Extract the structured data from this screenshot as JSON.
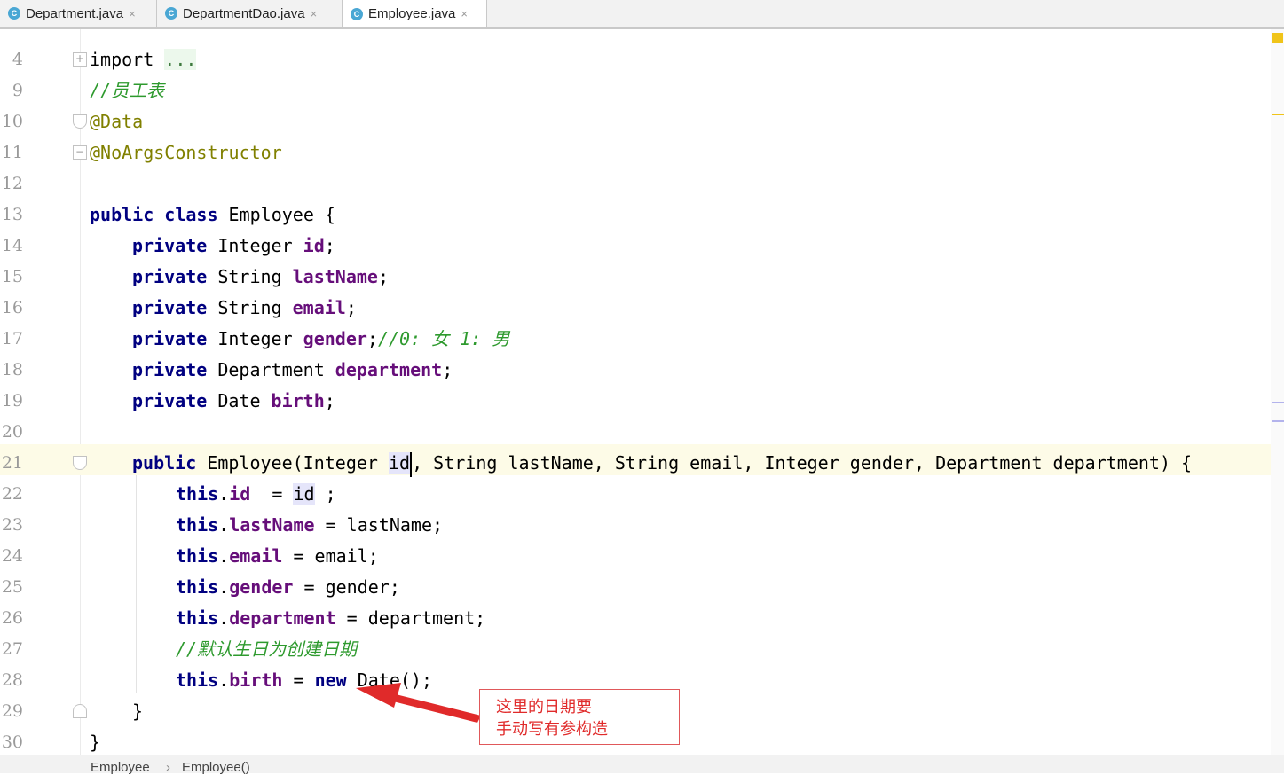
{
  "tabs": [
    {
      "label": "Department.java",
      "icon": "java-class-icon",
      "active": false
    },
    {
      "label": "DepartmentDao.java",
      "icon": "java-class-icon",
      "active": false
    },
    {
      "label": "Employee.java",
      "icon": "java-class-icon",
      "active": true
    }
  ],
  "tab_icon_letter": "C",
  "tab_close_glyph": "×",
  "editor": {
    "lines": {
      "l4": "4",
      "l9": "9",
      "l10": "10",
      "l11": "11",
      "l12": "12",
      "l13": "13",
      "l14": "14",
      "l15": "15",
      "l16": "16",
      "l17": "17",
      "l18": "18",
      "l19": "19",
      "l20": "20",
      "l21": "21",
      "l22": "22",
      "l23": "23",
      "l24": "24",
      "l25": "25",
      "l26": "26",
      "l27": "27",
      "l28": "28",
      "l29": "29",
      "l30": "30"
    },
    "code": {
      "import_kw": "import",
      "import_dots": "...",
      "comment_table": "//员工表",
      "ann_data": "@Data",
      "ann_noargs": "@NoArgsConstructor",
      "kw_public": "public",
      "kw_class": "class",
      "kw_private": "private",
      "kw_this": "this",
      "kw_new": "new",
      "class_decl_rest": " Employee {",
      "t_integer": " Integer ",
      "t_string": " String ",
      "t_department": " Department ",
      "t_date": " Date ",
      "f_id": "id",
      "f_lastName": "lastName",
      "f_email": "email",
      "f_gender": "gender",
      "f_department": "department",
      "f_birth": "birth",
      "semi": ";",
      "comment_gender": "//0: 女 1: 男",
      "ctor_head": " Employee(Integer ",
      "ctor_param_id": "id",
      "ctor_tail": ", String lastName, String email, Integer gender, Department department) {",
      "dot": ".",
      "assign_id_pre": "  = ",
      "assign_id_var": "id",
      "assign_id_post": " ;",
      "assign_lastName": " = lastName;",
      "assign_email": " = email;",
      "assign_gender": " = gender;",
      "assign_department": " = department;",
      "comment_birth": "//默认生日为创建日期",
      "assign_birth_pre": " = ",
      "assign_birth_post": " Date();",
      "close_brace": "}"
    }
  },
  "annotation": {
    "line1": "这里的日期要",
    "line2": "手动写有参构造"
  },
  "breadcrumb": {
    "item1": "Employee",
    "separator": "›",
    "item2": "Employee()"
  },
  "colors": {
    "keyword": "#000080",
    "field": "#660e7a",
    "annotation": "#808000",
    "comment": "#2e9a2e",
    "note_red": "#e02a2a"
  }
}
